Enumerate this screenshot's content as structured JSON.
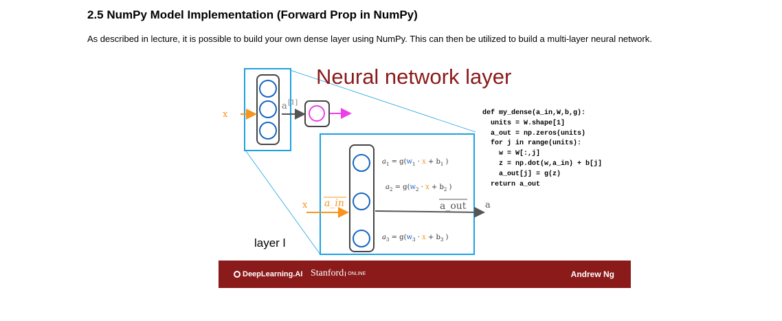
{
  "section_heading": "2.5 NumPy Model Implementation (Forward Prop in NumPy)",
  "intro_text": "As described in lecture, it is possible to build your own dense layer using NumPy. This can then be utilized to build a multi-layer neural network.",
  "slide": {
    "title": "Neural network layer",
    "layer_label": "layer l",
    "code": "def my_dense(a_in,W,b,g):\n  units = W.shape[1]\n  a_out = np.zeros(units)\n  for j in range(units):\n    w = W[:,j]\n    z = np.dot(w,a_in) + b[j]\n    a_out[j] = g(z)\n  return a_out",
    "small_net": {
      "input_label": "x",
      "activation_label": "a",
      "activation_superscript": "[1]"
    },
    "big_net": {
      "input_label": "x",
      "a_in_label": "a_in",
      "a_out_label": "a_out",
      "output_label": "a",
      "equations": [
        {
          "lhs": "a",
          "sub": "1",
          "w_sub": "1",
          "b_sub": "1"
        },
        {
          "lhs": "a",
          "sub": "2",
          "w_sub": "2",
          "b_sub": "2"
        },
        {
          "lhs": "a",
          "sub": "3",
          "w_sub": "3",
          "b_sub": "3"
        }
      ]
    },
    "footer": {
      "deeplearning": "DeepLearning.AI",
      "stanford": "Stanford",
      "online": "ONLINE",
      "author": "Andrew Ng"
    },
    "colors": {
      "title": "#8b1a1a",
      "blue_box": "#1ba1e2",
      "input_arrow": "#f7941d",
      "output_arrow": "#ee3ee8",
      "neuron": "#1565c0",
      "footer_bg": "#8b1a1a"
    }
  }
}
